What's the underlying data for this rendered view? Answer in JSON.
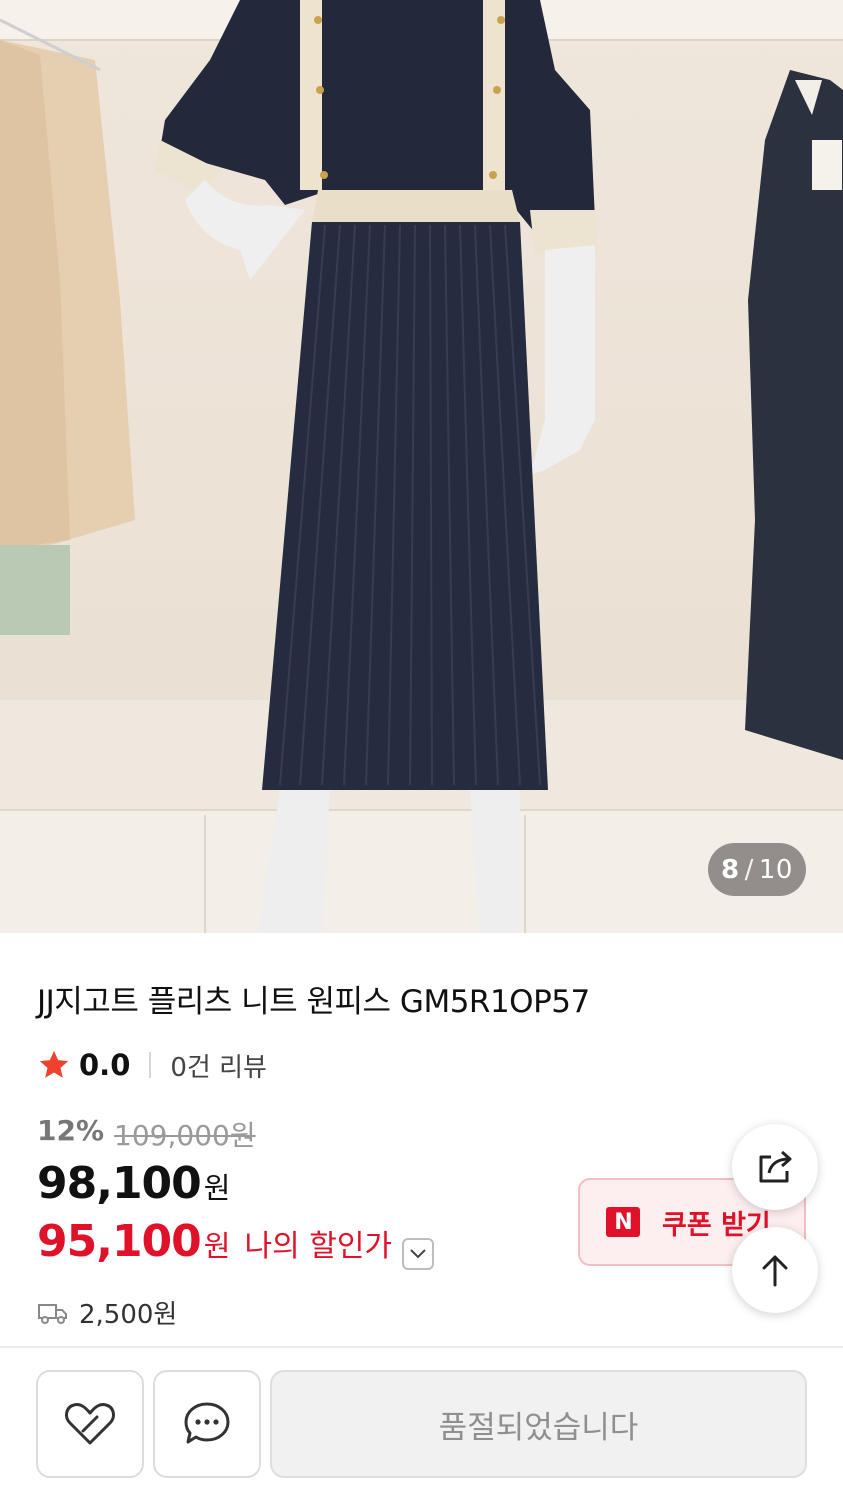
{
  "gallery": {
    "current_index": "8",
    "separator": "/",
    "total": "10"
  },
  "product": {
    "title": "JJ지고트 플리츠 니트 원피스 GM5R1OP57",
    "rating": "0.0",
    "review_count": "0건 리뷰",
    "discount_rate": "12%",
    "original_price": "109,000원",
    "sale_price": "98,100",
    "sale_price_unit": "원",
    "my_price": "95,100",
    "my_price_unit": "원",
    "my_price_label": "나의 할인가",
    "shipping_fee": "2,500원"
  },
  "coupon": {
    "logo_text": "N",
    "label": "쿠폰 받기"
  },
  "bottom_bar": {
    "sold_out_label": "품절되었습니다"
  },
  "icons": {
    "star": "star-icon",
    "shipping": "truck-icon",
    "share": "share-icon",
    "scroll_top": "arrow-up-icon",
    "like": "heart-icon",
    "chat": "chat-bubble-icon",
    "expand": "chevron-down-icon"
  },
  "colors": {
    "accent_red": "#e0122a",
    "star": "#f0402e",
    "coupon_bg": "#fdeef0",
    "sold_out_bg": "#f1f1f1"
  }
}
